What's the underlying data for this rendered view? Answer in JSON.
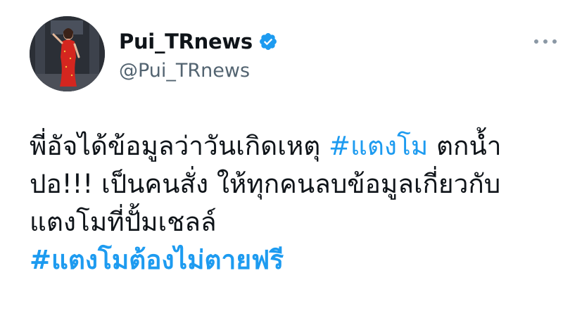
{
  "account": {
    "display_name": "Pui_TRnews",
    "handle": "@Pui_TRnews",
    "verified": true,
    "avatar": "profile-photo"
  },
  "tweet": {
    "line1_text": "พี่อัจได้ข้อมูลว่าวันเกิดเหตุ ",
    "line1_hashtag": "#แตงโม",
    "line1_tail": " ตกน้ำ",
    "line2": "ปอ!!! เป็นคนสั่ง ให้ทุกคนลบข้อมูลเกี่ยวกับ",
    "line3": "แตงโมที่ปั้มเชลล์",
    "closing_hashtag": "#แตงโมต้องไม่ตายฟรี"
  },
  "icons": {
    "verified": "verified-badge-icon",
    "more": "more-options-icon"
  },
  "colors": {
    "link": "#1d9bf0",
    "text": "#0f1419",
    "secondary": "#536471",
    "verified": "#1d9bf0"
  }
}
